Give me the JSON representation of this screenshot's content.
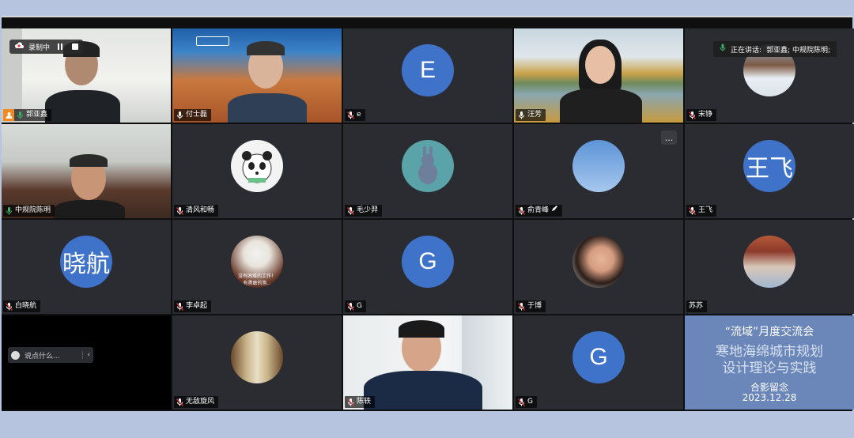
{
  "recording": {
    "label": "录制中"
  },
  "speaking": {
    "prefix": "正在讲话:",
    "names": "郭亚鑫; 中规院陈明;"
  },
  "tiles": [
    {
      "name": "郭亚鑫",
      "avatar": ""
    },
    {
      "name": "付士磊",
      "avatar": ""
    },
    {
      "name": "e",
      "avatar": "E"
    },
    {
      "name": "汪芳",
      "avatar": ""
    },
    {
      "name": "宋铮",
      "avatar": ""
    },
    {
      "name": "中规院陈明",
      "avatar": ""
    },
    {
      "name": "清风和畅",
      "avatar": ""
    },
    {
      "name": "毛少羿",
      "avatar": ""
    },
    {
      "name": "俞青峰",
      "avatar": ""
    },
    {
      "name": "王飞",
      "avatar": "王飞"
    },
    {
      "name": "白晓航",
      "avatar": "晓航"
    },
    {
      "name": "李卓起",
      "avatar": ""
    },
    {
      "name": "G",
      "avatar": "G"
    },
    {
      "name": "于博",
      "avatar": ""
    },
    {
      "name": "苏苏",
      "avatar": ""
    },
    {
      "name": "",
      "avatar": ""
    },
    {
      "name": "无敌旋风",
      "avatar": ""
    },
    {
      "name": "陈轶",
      "avatar": ""
    },
    {
      "name": "G",
      "avatar": "G"
    },
    {
      "name": "",
      "avatar": ""
    }
  ],
  "chat": {
    "placeholder": "说点什么..."
  },
  "more": {
    "label": "..."
  },
  "avatar_caption": {
    "line1": "没有困难的工作！",
    "line2": "有勇敢的狗..."
  },
  "slide": {
    "title": "“流域”月度交流会",
    "subtitle_line1": "寒地海绵城市规划",
    "subtitle_line2": "设计理论与实践",
    "caption": "合影留念",
    "date": "2023.12.28"
  },
  "colors": {
    "avatar_blue": "#3f72c9",
    "active_border": "#3bb26a",
    "tile_bg": "#2a2c31",
    "slide_bg": "#6b86b8"
  }
}
